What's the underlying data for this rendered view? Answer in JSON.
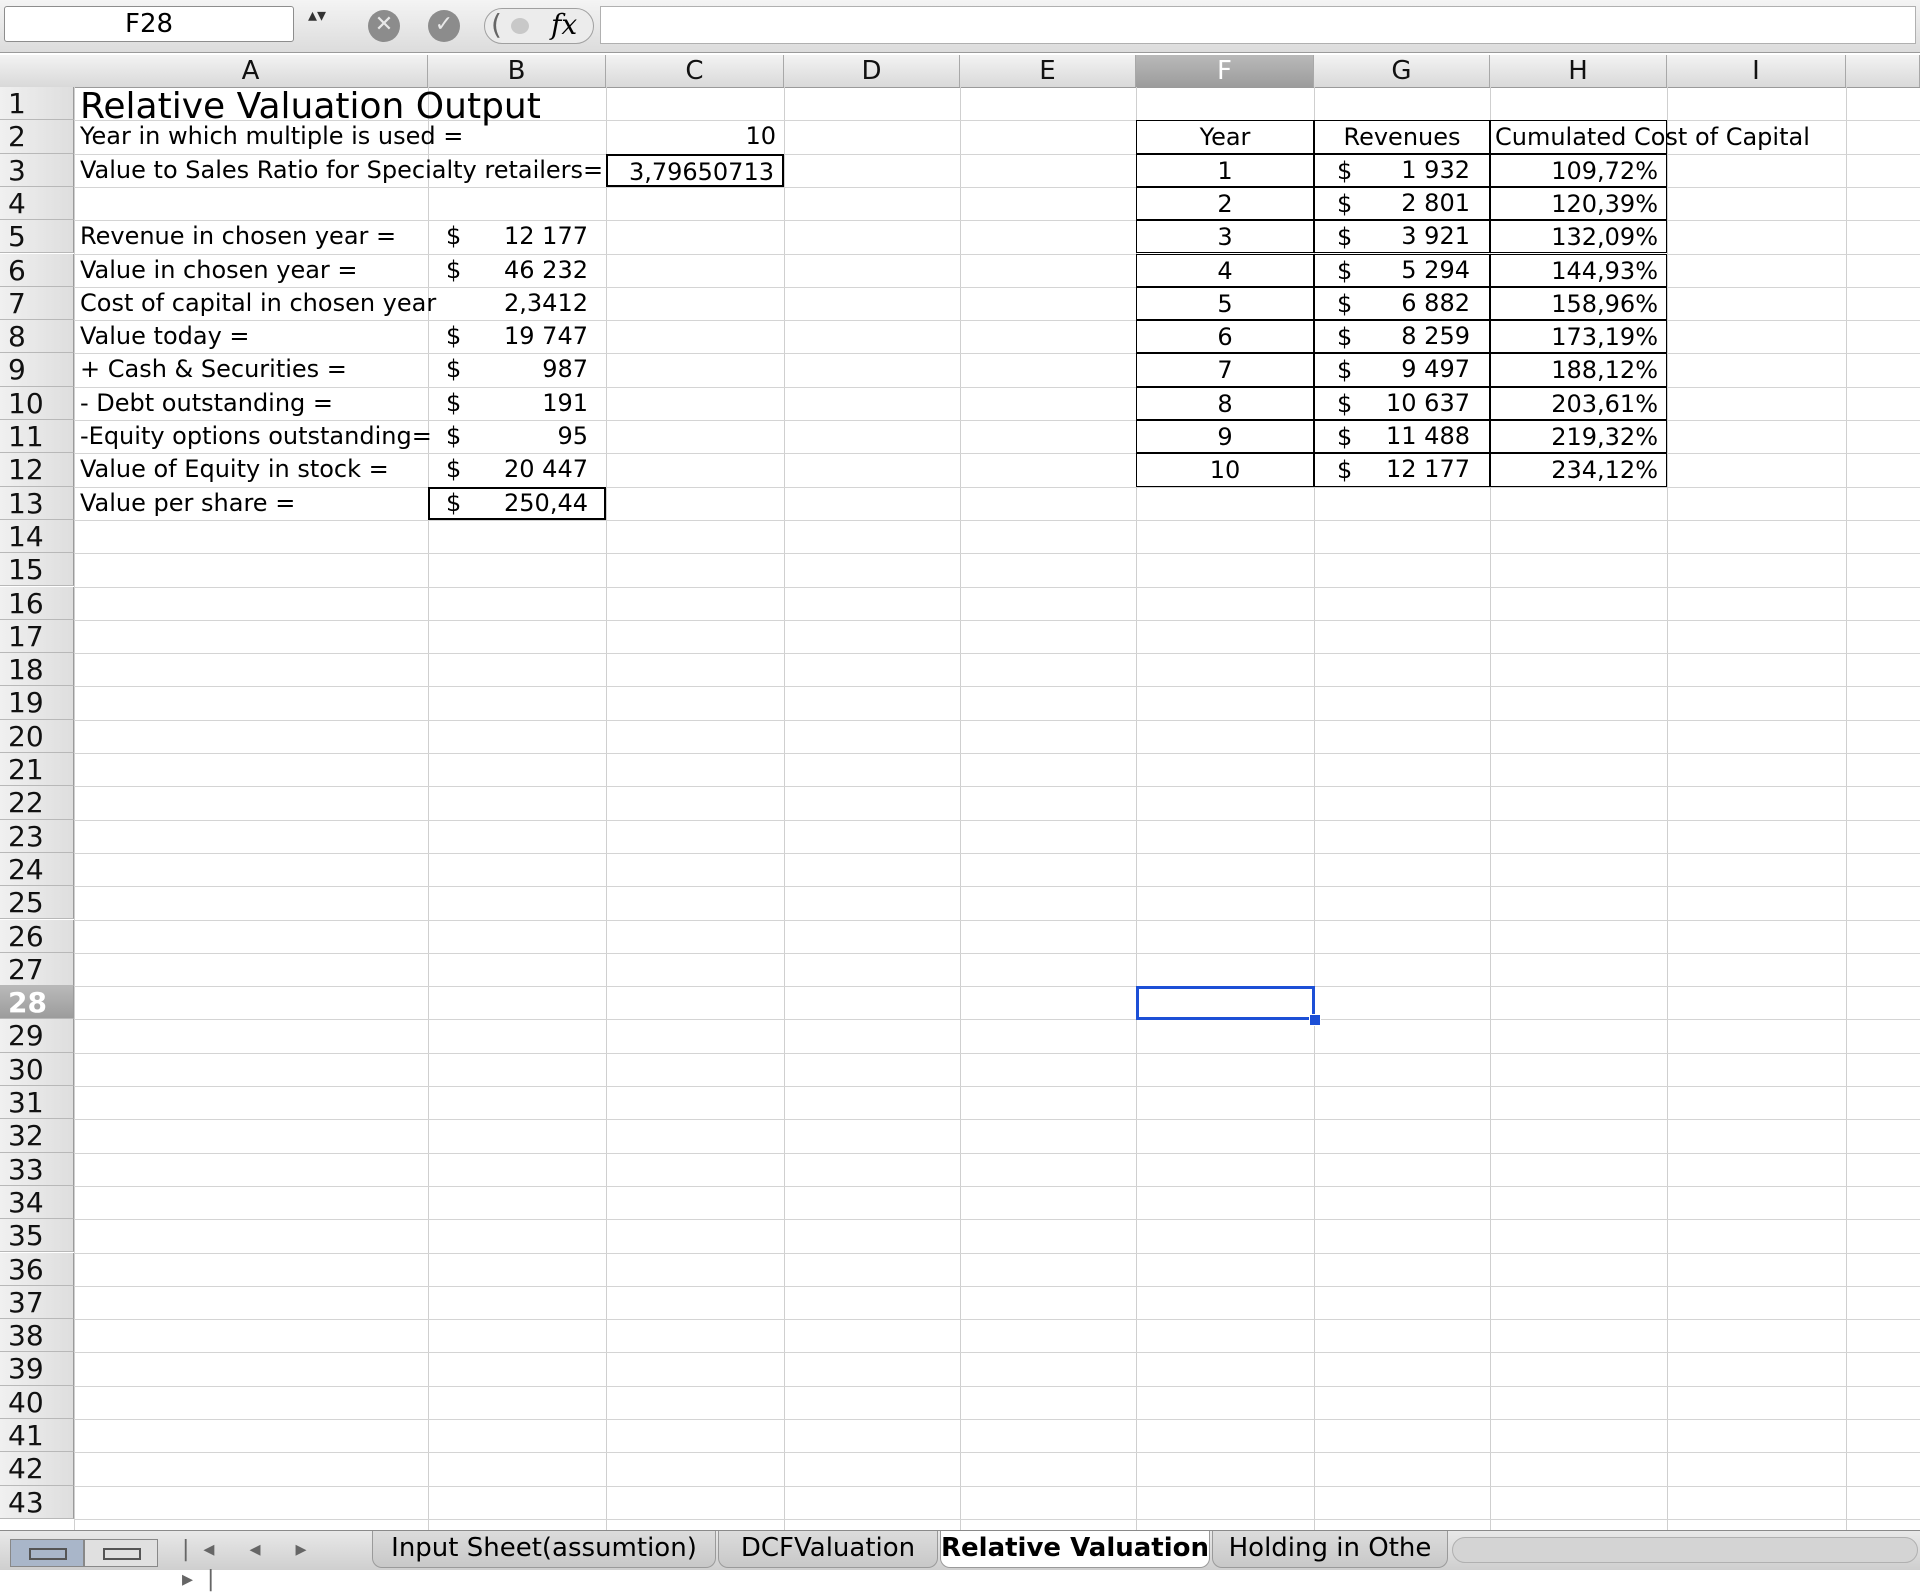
{
  "formula_bar": {
    "name_box": "F28",
    "stepper_glyph": "▴▾",
    "cancel_icon": "✕",
    "enter_icon": "✓",
    "fx_label": "fx"
  },
  "columns": [
    "A",
    "B",
    "C",
    "D",
    "E",
    "F",
    "G",
    "H",
    "I"
  ],
  "rows": [
    "1",
    "2",
    "3",
    "4",
    "5",
    "6",
    "7",
    "8",
    "9",
    "10",
    "11",
    "12",
    "13",
    "14",
    "15",
    "16",
    "17",
    "18",
    "19",
    "20",
    "21",
    "22",
    "23",
    "24",
    "25",
    "26",
    "27",
    "28",
    "29",
    "30",
    "31",
    "32",
    "33",
    "34",
    "35",
    "36",
    "37",
    "38",
    "39",
    "40",
    "41",
    "42",
    "43"
  ],
  "sheet": {
    "title": "Relative Valuation Output",
    "year_label": "Year in which multiple is used =",
    "year_value": "10",
    "ratio_label": "Value to Sales Ratio for Specialty retailers=",
    "ratio_value": "3,79650713",
    "lines": [
      {
        "label": "Revenue in chosen year =",
        "cur": "$",
        "value": "12 177"
      },
      {
        "label": "Value in chosen year =",
        "cur": "$",
        "value": "46 232"
      },
      {
        "label": "Cost of capital in chosen year",
        "cur": "",
        "value": "2,3412"
      },
      {
        "label": "Value today =",
        "cur": "$",
        "value": "19 747"
      },
      {
        "label": " + Cash & Securities =",
        "cur": "$",
        "value": "987"
      },
      {
        "label": "  - Debt outstanding =",
        "cur": "$",
        "value": "191"
      },
      {
        "label": " -Equity options outstanding=",
        "cur": "$",
        "value": "95"
      },
      {
        "label": "Value of Equity in stock =",
        "cur": "$",
        "value": "20 447"
      },
      {
        "label": "Value per share =",
        "cur": "$",
        "value": "250,44"
      }
    ],
    "table": {
      "headers": [
        "Year",
        "Revenues",
        "Cumulated Cost of Capital"
      ],
      "rows": [
        {
          "year": "1",
          "cur": "$",
          "rev": "1 932",
          "ccc": "109,72%"
        },
        {
          "year": "2",
          "cur": "$",
          "rev": "2 801",
          "ccc": "120,39%"
        },
        {
          "year": "3",
          "cur": "$",
          "rev": "3 921",
          "ccc": "132,09%"
        },
        {
          "year": "4",
          "cur": "$",
          "rev": "5 294",
          "ccc": "144,93%"
        },
        {
          "year": "5",
          "cur": "$",
          "rev": "6 882",
          "ccc": "158,96%"
        },
        {
          "year": "6",
          "cur": "$",
          "rev": "8 259",
          "ccc": "173,19%"
        },
        {
          "year": "7",
          "cur": "$",
          "rev": "9 497",
          "ccc": "188,12%"
        },
        {
          "year": "8",
          "cur": "$",
          "rev": "10 637",
          "ccc": "203,61%"
        },
        {
          "year": "9",
          "cur": "$",
          "rev": "11 488",
          "ccc": "219,32%"
        },
        {
          "year": "10",
          "cur": "$",
          "rev": "12 177",
          "ccc": "234,12%"
        }
      ]
    }
  },
  "tabs": {
    "nav": "|◂ ◂ ▸ ▸|",
    "items": [
      "Input Sheet(assumtion)",
      "DCFValuation",
      "Relative Valuation",
      "Holding in Othe"
    ],
    "active_index": 2
  },
  "colors": {
    "selection": "#1c4fd6"
  }
}
